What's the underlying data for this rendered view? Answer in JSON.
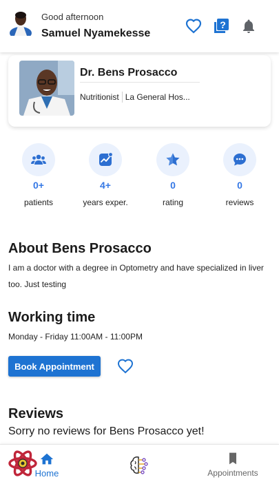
{
  "header": {
    "greeting": "Good afternoon",
    "user_name": "Samuel Nyamekesse",
    "icons": [
      "heart-outline-icon",
      "help-box-icon",
      "bell-icon"
    ],
    "accent": "#1e73d2"
  },
  "doctor": {
    "name": "Dr. Bens Prosacco",
    "specialty": "Nutritionist",
    "hospital": "La General Hos..."
  },
  "stats": [
    {
      "value": "0+",
      "label": "patients",
      "icon": "group-icon"
    },
    {
      "value": "4+",
      "label": "years exper.",
      "icon": "trending-icon"
    },
    {
      "value": "0",
      "label": "rating",
      "icon": "star-icon"
    },
    {
      "value": "0",
      "label": "reviews",
      "icon": "chat-icon"
    }
  ],
  "about": {
    "title": "About Bens Prosacco",
    "text": "I am a doctor with a degree in Optometry and have specialized in liver too. Just testing"
  },
  "working": {
    "title": "Working time",
    "hours": "Monday - Friday 11:00AM - 11:00PM"
  },
  "actions": {
    "book_label": "Book Appointment"
  },
  "reviews": {
    "title": "Reviews",
    "empty_text": "Sorry no reviews for Bens Prosacco yet!"
  },
  "nav": {
    "home_label": "Home",
    "appointments_label": "Appointments"
  }
}
